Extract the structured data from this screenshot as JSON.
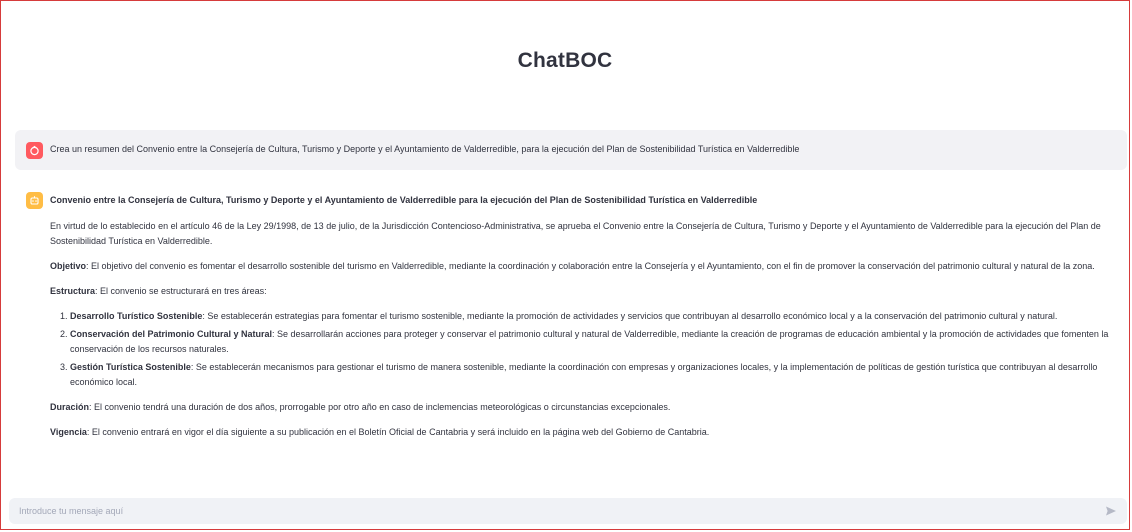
{
  "app": {
    "title": "ChatBOC"
  },
  "user_message": {
    "text": "Crea un resumen del Convenio entre la Consejería de Cultura, Turismo y Deporte y el Ayuntamiento de Valderredible, para la ejecución del Plan de Sostenibilidad Turística en Valderredible"
  },
  "assistant_message": {
    "heading": "Convenio entre la Consejería de Cultura, Turismo y Deporte y el Ayuntamiento de Valderredible para la ejecución del Plan de Sostenibilidad Turística en Valderredible",
    "intro": "En virtud de lo establecido en el artículo 46 de la Ley 29/1998, de 13 de julio, de la Jurisdicción Contencioso-Administrativa, se aprueba el Convenio entre la Consejería de Cultura, Turismo y Deporte y el Ayuntamiento de Valderredible para la ejecución del Plan de Sostenibilidad Turística en Valderredible.",
    "objetivo_label": "Objetivo",
    "objetivo_text": ": El objetivo del convenio es fomentar el desarrollo sostenible del turismo en Valderredible, mediante la coordinación y colaboración entre la Consejería y el Ayuntamiento, con el fin de promover la conservación del patrimonio cultural y natural de la zona.",
    "estructura_label": "Estructura",
    "estructura_text": ": El convenio se estructurará en tres áreas:",
    "areas": [
      {
        "label": "Desarrollo Turístico Sostenible",
        "text": ": Se establecerán estrategias para fomentar el turismo sostenible, mediante la promoción de actividades y servicios que contribuyan al desarrollo económico local y a la conservación del patrimonio cultural y natural."
      },
      {
        "label": "Conservación del Patrimonio Cultural y Natural",
        "text": ": Se desarrollarán acciones para proteger y conservar el patrimonio cultural y natural de Valderredible, mediante la creación de programas de educación ambiental y la promoción de actividades que fomenten la conservación de los recursos naturales."
      },
      {
        "label": "Gestión Turística Sostenible",
        "text": ": Se establecerán mecanismos para gestionar el turismo de manera sostenible, mediante la coordinación con empresas y organizaciones locales, y la implementación de políticas de gestión turística que contribuyan al desarrollo económico local."
      }
    ],
    "duracion_label": "Duración",
    "duracion_text": ": El convenio tendrá una duración de dos años, prorrogable por otro año en caso de inclemencias meteorológicas o circunstancias excepcionales.",
    "vigencia_label": "Vigencia",
    "vigencia_text": ": El convenio entrará en vigor el día siguiente a su publicación en el Boletín Oficial de Cantabria y será incluido en la página web del Gobierno de Cantabria."
  },
  "chat_input": {
    "placeholder": "Introduce tu mensaje aquí"
  },
  "colors": {
    "user_avatar": "#ff5a5f",
    "bot_avatar": "#ffbd45",
    "frame_border": "#d63b3b"
  }
}
